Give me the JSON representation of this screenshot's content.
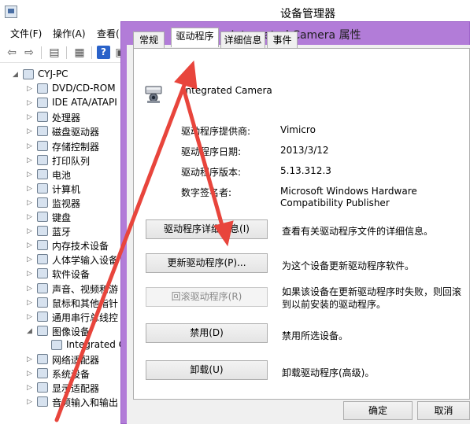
{
  "device_manager": {
    "title": "设备管理器",
    "menu": [
      {
        "label": "文件(F)"
      },
      {
        "label": "操作(A)"
      },
      {
        "label": "查看("
      }
    ],
    "tree": [
      {
        "label": "CYJ-PC",
        "level": 0,
        "expander": "◢",
        "icon": "computer-icon"
      },
      {
        "label": "DVD/CD-ROM",
        "level": 1,
        "expander": "▷",
        "icon": "dvd-drive-icon"
      },
      {
        "label": "IDE ATA/ATAPI",
        "level": 1,
        "expander": "▷",
        "icon": "ide-controller-icon"
      },
      {
        "label": "处理器",
        "level": 1,
        "expander": "▷",
        "icon": "processor-icon"
      },
      {
        "label": "磁盘驱动器",
        "level": 1,
        "expander": "▷",
        "icon": "disk-drive-icon"
      },
      {
        "label": "存储控制器",
        "level": 1,
        "expander": "▷",
        "icon": "storage-controller-icon"
      },
      {
        "label": "打印队列",
        "level": 1,
        "expander": "▷",
        "icon": "printer-icon"
      },
      {
        "label": "电池",
        "level": 1,
        "expander": "▷",
        "icon": "battery-icon"
      },
      {
        "label": "计算机",
        "level": 1,
        "expander": "▷",
        "icon": "computer-icon"
      },
      {
        "label": "监视器",
        "level": 1,
        "expander": "▷",
        "icon": "monitor-icon"
      },
      {
        "label": "键盘",
        "level": 1,
        "expander": "▷",
        "icon": "keyboard-icon"
      },
      {
        "label": "蓝牙",
        "level": 1,
        "expander": "▷",
        "icon": "bluetooth-icon"
      },
      {
        "label": "内存技术设备",
        "level": 1,
        "expander": "▷",
        "icon": "memory-device-icon"
      },
      {
        "label": "人体学输入设备",
        "level": 1,
        "expander": "▷",
        "icon": "hid-icon"
      },
      {
        "label": "软件设备",
        "level": 1,
        "expander": "▷",
        "icon": "software-device-icon"
      },
      {
        "label": "声音、视频和游",
        "level": 1,
        "expander": "▷",
        "icon": "sound-icon"
      },
      {
        "label": "鼠标和其他指针",
        "level": 1,
        "expander": "▷",
        "icon": "mouse-icon"
      },
      {
        "label": "通用串行总线控",
        "level": 1,
        "expander": "▷",
        "icon": "usb-icon"
      },
      {
        "label": "图像设备",
        "level": 1,
        "expander": "◢",
        "icon": "imaging-device-icon"
      },
      {
        "label": "Integrated C",
        "level": 2,
        "expander": "",
        "icon": "camera-icon"
      },
      {
        "label": "网络适配器",
        "level": 1,
        "expander": "▷",
        "icon": "network-adapter-icon"
      },
      {
        "label": "系统设备",
        "level": 1,
        "expander": "▷",
        "icon": "system-device-icon"
      },
      {
        "label": "显示适配器",
        "level": 1,
        "expander": "▷",
        "icon": "display-adapter-icon"
      },
      {
        "label": "音频输入和输出",
        "level": 1,
        "expander": "▷",
        "icon": "audio-icon"
      }
    ]
  },
  "dialog": {
    "title": "Integrated Camera 属性",
    "tabs": [
      {
        "label": "常规",
        "active": false
      },
      {
        "label": "驱动程序",
        "active": true
      },
      {
        "label": "详细信息",
        "active": false
      },
      {
        "label": "事件",
        "active": false
      }
    ],
    "device_name": "Integrated Camera",
    "properties": [
      {
        "label": "驱动程序提供商:",
        "value": "Vimicro"
      },
      {
        "label": "驱动程序日期:",
        "value": "2013/3/12"
      },
      {
        "label": "驱动程序版本:",
        "value": "5.13.312.3"
      },
      {
        "label": "数字签名者:",
        "value": "Microsoft Windows Hardware Compatibility Publisher"
      }
    ],
    "actions": [
      {
        "button": "驱动程序详细信息(I)",
        "description": "查看有关驱动程序文件的详细信息。",
        "enabled": true
      },
      {
        "button": "更新驱动程序(P)...",
        "description": "为这个设备更新驱动程序软件。",
        "enabled": true
      },
      {
        "button": "回滚驱动程序(R)",
        "description": "如果该设备在更新驱动程序时失败，则回滚到以前安装的驱动程序。",
        "enabled": false
      },
      {
        "button": "禁用(D)",
        "description": "禁用所选设备。",
        "enabled": true
      },
      {
        "button": "卸载(U)",
        "description": "卸载驱动程序(高级)。",
        "enabled": true
      }
    ],
    "ok_label": "确定",
    "cancel_label": "取消"
  },
  "colors": {
    "dialog_frame": "#b27cd8",
    "annotation_arrow": "#e8453c"
  }
}
